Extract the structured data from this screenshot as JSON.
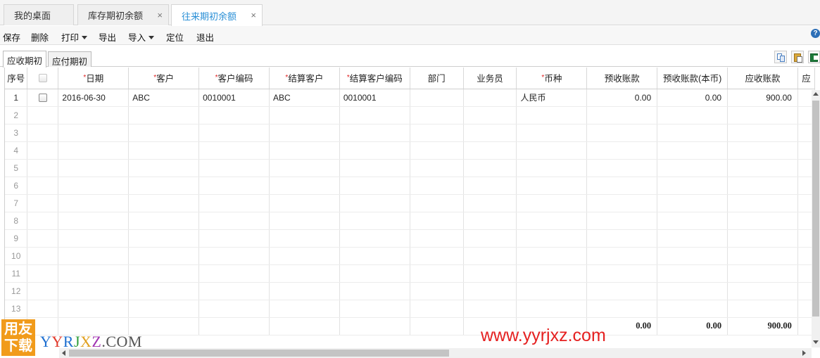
{
  "tabs": [
    {
      "label": "我的桌面",
      "closable": false,
      "active": false
    },
    {
      "label": "库存期初余额",
      "closable": true,
      "active": false
    },
    {
      "label": "往来期初余额",
      "closable": true,
      "active": true
    }
  ],
  "close_glyph": "×",
  "toolbar": {
    "save": "保存",
    "delete": "删除",
    "print": "打印",
    "export": "导出",
    "import": "导入",
    "locate": "定位",
    "exit": "退出",
    "help_glyph": "?"
  },
  "subtabs": {
    "receivable": "应收期初",
    "payable": "应付期初"
  },
  "toolbar_icons": [
    "copy-icon",
    "paste-icon",
    "excel-export-icon"
  ],
  "table": {
    "columns": [
      {
        "label": "序号",
        "required": false
      },
      {
        "label": "",
        "required": false
      },
      {
        "label": "日期",
        "required": true
      },
      {
        "label": "客户",
        "required": true
      },
      {
        "label": "客户编码",
        "required": true
      },
      {
        "label": "结算客户",
        "required": true
      },
      {
        "label": "结算客户编码",
        "required": true
      },
      {
        "label": "部门",
        "required": false
      },
      {
        "label": "业务员",
        "required": false
      },
      {
        "label": "币种",
        "required": true
      },
      {
        "label": "预收账款",
        "required": false
      },
      {
        "label": "预收账款(本币)",
        "required": false
      },
      {
        "label": "应收账款",
        "required": false
      },
      {
        "label": "应",
        "required": false
      }
    ],
    "rows": [
      {
        "idx": "1",
        "date": "2016-06-30",
        "customer": "ABC",
        "customer_code": "0010001",
        "settle_customer": "ABC",
        "settle_code": "0010001",
        "dept": "",
        "salesman": "",
        "currency": "人民币",
        "advance": "0.00",
        "advance_local": "0.00",
        "receivable": "900.00"
      },
      {
        "idx": "2"
      },
      {
        "idx": "3"
      },
      {
        "idx": "4"
      },
      {
        "idx": "5"
      },
      {
        "idx": "6"
      },
      {
        "idx": "7"
      },
      {
        "idx": "8"
      },
      {
        "idx": "9"
      },
      {
        "idx": "10"
      },
      {
        "idx": "11"
      },
      {
        "idx": "12"
      },
      {
        "idx": "13"
      }
    ],
    "totals": {
      "advance": "0.00",
      "advance_local": "0.00",
      "receivable": "900.00"
    }
  },
  "watermark": {
    "logo_line1": "用友",
    "logo_line2": "下载",
    "site_letters": [
      {
        "ch": "Y",
        "color": "#1e6fd0"
      },
      {
        "ch": "Y",
        "color": "#e03a2c"
      },
      {
        "ch": "R",
        "color": "#1e6fd0"
      },
      {
        "ch": "J",
        "color": "#2d9d3a"
      },
      {
        "ch": "X",
        "color": "#e0a020"
      },
      {
        "ch": "Z",
        "color": "#a033b0"
      },
      {
        "ch": ".COM",
        "color": "#555555"
      }
    ],
    "url": "www.yyrjxz.com"
  },
  "colors": {
    "accent": "#2a8fd6",
    "required_mark": "#e02020",
    "url_red": "#e52020"
  }
}
